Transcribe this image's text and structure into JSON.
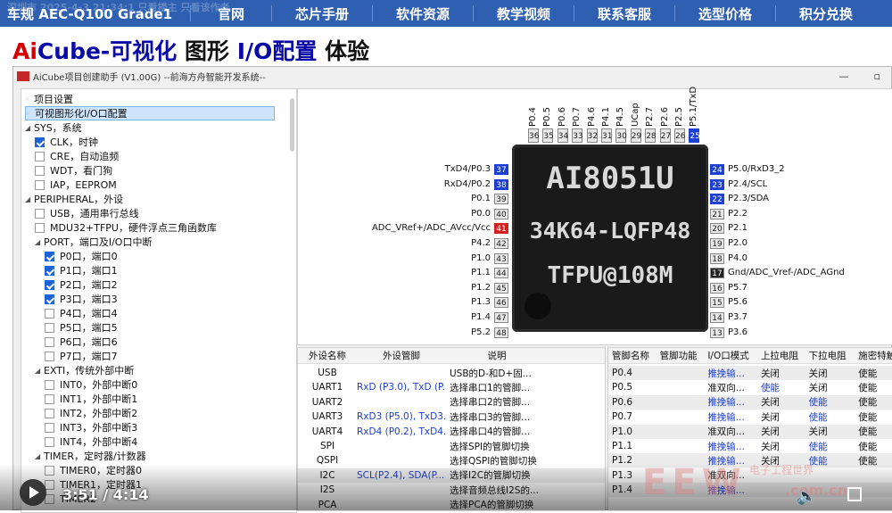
{
  "nav": {
    "brand": "车规 AEC-Q100 Grade1",
    "items": [
      "官网",
      "芯片手册",
      "软件资源",
      "教学视频",
      "联系客服",
      "选型价格",
      "积分兑换"
    ],
    "ghost": "深圳市 2025-4-3 21:34:1   只看楼主        只看该作者"
  },
  "headline": {
    "red": "Ai",
    "blue": "Cube-可视化",
    "black1": " 图形 ",
    "blue2": "I/O配置",
    "black2": " 体验"
  },
  "window": {
    "title": "AiCube项目创建助手 (V1.00G)  --前海方舟智能开发系统--",
    "min": "—",
    "max": "▫"
  },
  "tree": [
    {
      "label": "项目设置",
      "lvl": 0,
      "kind": "dot"
    },
    {
      "label": "可视图形化I/O口配置",
      "lvl": 0,
      "kind": "dot",
      "sel": true
    },
    {
      "label": "SYS，系统",
      "lvl": 0,
      "kind": "arr"
    },
    {
      "label": "CLK，时钟",
      "lvl": 1,
      "kind": "cb",
      "on": true
    },
    {
      "label": "CRE，自动追频",
      "lvl": 1,
      "kind": "cb"
    },
    {
      "label": "WDT，看门狗",
      "lvl": 1,
      "kind": "cb"
    },
    {
      "label": "IAP，EEPROM",
      "lvl": 1,
      "kind": "cb"
    },
    {
      "label": "PERIPHERAL，外设",
      "lvl": 0,
      "kind": "arr"
    },
    {
      "label": "USB，通用串行总线",
      "lvl": 1,
      "kind": "cb"
    },
    {
      "label": "MDU32+TFPU，硬件浮点三角函数库",
      "lvl": 1,
      "kind": "cb"
    },
    {
      "label": "PORT，端口及I/O口中断",
      "lvl": 1,
      "kind": "arr"
    },
    {
      "label": "P0口，端口0",
      "lvl": 2,
      "kind": "cb",
      "on": true
    },
    {
      "label": "P1口，端口1",
      "lvl": 2,
      "kind": "cb",
      "on": true
    },
    {
      "label": "P2口，端口2",
      "lvl": 2,
      "kind": "cb",
      "on": true
    },
    {
      "label": "P3口，端口3",
      "lvl": 2,
      "kind": "cb",
      "on": true
    },
    {
      "label": "P4口，端口4",
      "lvl": 2,
      "kind": "cb"
    },
    {
      "label": "P5口，端口5",
      "lvl": 2,
      "kind": "cb"
    },
    {
      "label": "P6口，端口6",
      "lvl": 2,
      "kind": "cb"
    },
    {
      "label": "P7口，端口7",
      "lvl": 2,
      "kind": "cb"
    },
    {
      "label": "EXTI，传统外部中断",
      "lvl": 1,
      "kind": "arr"
    },
    {
      "label": "INT0，外部中断0",
      "lvl": 2,
      "kind": "cb"
    },
    {
      "label": "INT1，外部中断1",
      "lvl": 2,
      "kind": "cb"
    },
    {
      "label": "INT2，外部中断2",
      "lvl": 2,
      "kind": "cb"
    },
    {
      "label": "INT3，外部中断3",
      "lvl": 2,
      "kind": "cb"
    },
    {
      "label": "INT4，外部中断4",
      "lvl": 2,
      "kind": "cb"
    },
    {
      "label": "TIMER，定时器/计数器",
      "lvl": 1,
      "kind": "arr"
    },
    {
      "label": "TIMER0，定时器0",
      "lvl": 2,
      "kind": "cb"
    },
    {
      "label": "TIMER1，定时器1",
      "lvl": 2,
      "kind": "cb"
    },
    {
      "label": "TIMER2",
      "lvl": 2,
      "kind": "cb"
    }
  ],
  "chip": {
    "line1": "AI8051U",
    "line2": "34K64-LQFP48",
    "line3": "TFPU@108M"
  },
  "top_pins": [
    {
      "num": "36",
      "label": "P0.4"
    },
    {
      "num": "35",
      "label": "P0.5"
    },
    {
      "num": "34",
      "label": "P0.6"
    },
    {
      "num": "33",
      "label": "P0.7"
    },
    {
      "num": "32",
      "label": "P4.6"
    },
    {
      "num": "31",
      "label": "P4.1"
    },
    {
      "num": "30",
      "label": "P4.5"
    },
    {
      "num": "29",
      "label": "UCap"
    },
    {
      "num": "28",
      "label": "P2.7"
    },
    {
      "num": "27",
      "label": "P2.6"
    },
    {
      "num": "26",
      "label": "P2.5"
    },
    {
      "num": "25",
      "label": "P5.1/TxD"
    }
  ],
  "left_pins": [
    {
      "num": "37",
      "label": "TxD4/P0.3",
      "style": "blue"
    },
    {
      "num": "38",
      "label": "RxD4/P0.2",
      "style": "blue"
    },
    {
      "num": "39",
      "label": "P0.1",
      "style": ""
    },
    {
      "num": "40",
      "label": "P0.0",
      "style": ""
    },
    {
      "num": "41",
      "label": "ADC_VRef+/ADC_AVcc/Vcc",
      "style": "red"
    },
    {
      "num": "42",
      "label": "P4.2",
      "style": ""
    },
    {
      "num": "43",
      "label": "P1.0",
      "style": ""
    },
    {
      "num": "44",
      "label": "P1.1",
      "style": ""
    },
    {
      "num": "45",
      "label": "P1.2",
      "style": ""
    },
    {
      "num": "46",
      "label": "P1.3",
      "style": ""
    },
    {
      "num": "47",
      "label": "P1.4",
      "style": ""
    },
    {
      "num": "48",
      "label": "P5.2",
      "style": ""
    }
  ],
  "right_pins": [
    {
      "num": "24",
      "label": "P5.0/RxD3_2",
      "style": "blue"
    },
    {
      "num": "23",
      "label": "P2.4/SCL",
      "style": "blue"
    },
    {
      "num": "22",
      "label": "P2.3/SDA",
      "style": "blue"
    },
    {
      "num": "21",
      "label": "P2.2",
      "style": ""
    },
    {
      "num": "20",
      "label": "P2.1",
      "style": ""
    },
    {
      "num": "19",
      "label": "P2.0",
      "style": ""
    },
    {
      "num": "18",
      "label": "P4.0",
      "style": ""
    },
    {
      "num": "17",
      "label": "Gnd/ADC_Vref-/ADC_AGnd",
      "style": "dark"
    },
    {
      "num": "16",
      "label": "P5.7",
      "style": ""
    },
    {
      "num": "15",
      "label": "P5.6",
      "style": ""
    },
    {
      "num": "14",
      "label": "P3.7",
      "style": ""
    },
    {
      "num": "13",
      "label": "P3.6",
      "style": ""
    }
  ],
  "periph_table": {
    "headers": [
      "外设名称",
      "外设管脚",
      "说明"
    ],
    "rows": [
      {
        "name": "USB",
        "pins": "",
        "desc": "USB的D-和D+固..."
      },
      {
        "name": "UART1",
        "pins": "RxD (P3.0), TxD (P...",
        "desc": "选择串口1的管脚..."
      },
      {
        "name": "UART2",
        "pins": "",
        "desc": "选择串口2的管脚..."
      },
      {
        "name": "UART3",
        "pins": "RxD3 (P5.0), TxD3...",
        "desc": "选择串口3的管脚..."
      },
      {
        "name": "UART4",
        "pins": "RxD4 (P0.2), TxD4...",
        "desc": "选择串口4的管脚..."
      },
      {
        "name": "SPI",
        "pins": "",
        "desc": "选择SPI的管脚切换"
      },
      {
        "name": "QSPI",
        "pins": "",
        "desc": "选择QSPI的管脚切换"
      },
      {
        "name": "I2C",
        "pins": "SCL(P2.4), SDA(P...",
        "desc": "选择I2C的管脚切换",
        "sel": true
      },
      {
        "name": "I2S",
        "pins": "",
        "desc": "选择音频总线I2S的..."
      },
      {
        "name": "PCA",
        "pins": "",
        "desc": "选择PCA的管脚切换"
      }
    ]
  },
  "pin_table": {
    "headers": [
      "管脚名称",
      "管脚功能",
      "I/O口模式",
      "上拉电阻",
      "下拉电阻",
      "施密特触..."
    ],
    "rows": [
      {
        "pin": "P0.4",
        "func": "",
        "mode": "推挽输...",
        "pu": "关闭",
        "pd": "关闭",
        "st": "使能"
      },
      {
        "pin": "P0.5",
        "func": "",
        "mode": "准双向...",
        "pu": "使能",
        "pd": "关闭",
        "st": "使能"
      },
      {
        "pin": "P0.6",
        "func": "",
        "mode": "推挽输...",
        "pu": "关闭",
        "pd": "使能",
        "st": "使能"
      },
      {
        "pin": "P0.7",
        "func": "",
        "mode": "推挽输...",
        "pu": "关闭",
        "pd": "使能",
        "st": "使能"
      },
      {
        "pin": "P1.0",
        "func": "",
        "mode": "准双向...",
        "pu": "关闭",
        "pd": "关闭",
        "st": "使能"
      },
      {
        "pin": "P1.1",
        "func": "",
        "mode": "推挽输...",
        "pu": "关闭",
        "pd": "使能",
        "st": "使能"
      },
      {
        "pin": "P1.2",
        "func": "",
        "mode": "推挽输...",
        "pu": "关闭",
        "pd": "使能",
        "st": "使能"
      },
      {
        "pin": "P1.3",
        "func": "",
        "mode": "准双向...",
        "pu": "",
        "pd": "",
        "st": ""
      },
      {
        "pin": "P1.4",
        "func": "",
        "mode": "推挽输...",
        "pu": "",
        "pd": "",
        "st": ""
      }
    ]
  },
  "video": {
    "time": "3:51 / 4:14",
    "progress": 0.92
  },
  "watermark": {
    "big": "EEW",
    "small": "电子工程世界",
    "url": ".com.cn"
  }
}
